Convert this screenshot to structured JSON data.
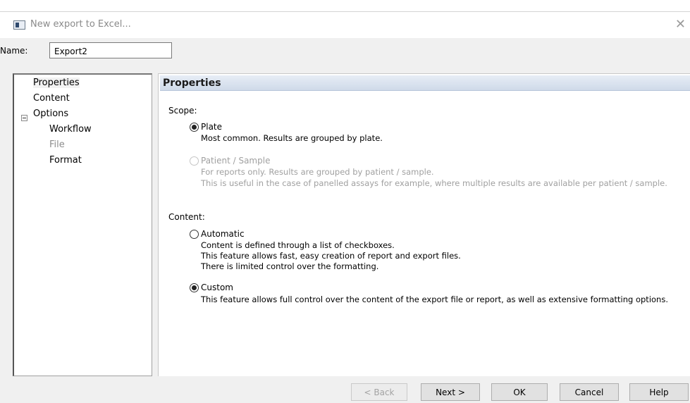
{
  "window": {
    "title": "New export to Excel...",
    "close": "✕",
    "app_icon": "window-icon"
  },
  "name_field": {
    "label": "Name:",
    "value": "Export2"
  },
  "nav": {
    "items": [
      {
        "label": "Properties",
        "selected": true
      },
      {
        "label": "Content"
      },
      {
        "label": "Options",
        "expanded": true,
        "expander_icon": "collapse-icon"
      },
      {
        "label": "Workflow"
      },
      {
        "label": "File",
        "disabled": true
      },
      {
        "label": "Format"
      }
    ]
  },
  "panel": {
    "title": "Properties",
    "scope": {
      "label": "Scope:",
      "options": [
        {
          "label": "Plate",
          "checked": true,
          "desc": [
            "Most common. Results are grouped by plate."
          ]
        },
        {
          "label": "Patient / Sample",
          "checked": false,
          "disabled": true,
          "desc": [
            "For reports only. Results are grouped by patient / sample.",
            "This is useful in the case of panelled assays for example, where multiple results are available per patient / sample."
          ]
        }
      ]
    },
    "content": {
      "label": "Content:",
      "options": [
        {
          "label": "Automatic",
          "checked": false,
          "desc": [
            "Content is defined through a list of checkboxes.",
            "This feature allows fast, easy creation of report and export files.",
            "There is limited control over the formatting."
          ]
        },
        {
          "label": "Custom",
          "checked": true,
          "desc": [
            "This feature allows full control over the content of the export file or report, as well as extensive formatting options."
          ]
        }
      ]
    }
  },
  "buttons": {
    "back": "< Back",
    "next": "Next >",
    "ok": "OK",
    "cancel": "Cancel",
    "help": "Help"
  },
  "colors": {
    "header_gradient_top": "#e7edf6",
    "header_gradient_bottom": "#cfdae9",
    "dialog_bg": "#f0f0f0"
  }
}
